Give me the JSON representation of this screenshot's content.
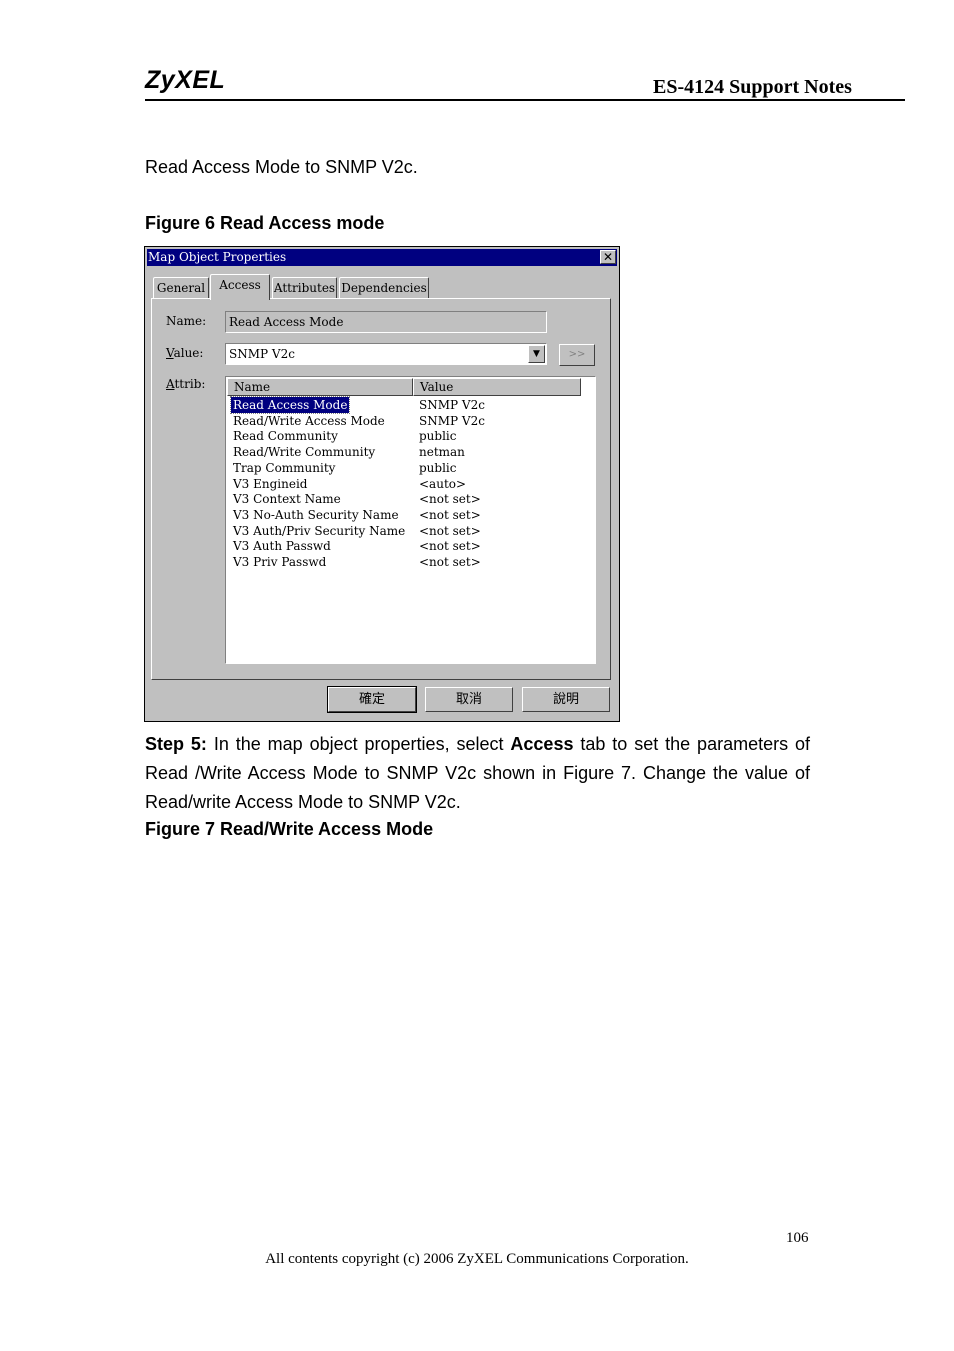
{
  "header": {
    "logo": "ZyXEL",
    "doc_title": "ES-4124 Support Notes"
  },
  "intro_text": "Read Access Mode to SNMP V2c.",
  "figure6_caption": "Figure 6 Read Access mode",
  "dialog": {
    "title": "Map Object Properties",
    "tabs": [
      "General",
      "Access",
      "Attributes",
      "Dependencies"
    ],
    "active_tab": "Access",
    "name_label": "Name:",
    "name_value": "Read Access Mode",
    "value_label_ul": "V",
    "value_label_rest": "alue:",
    "value_selected": "SNMP V2c",
    "more_button": ">>",
    "attrib_label_ul": "A",
    "attrib_label_rest": "ttrib:",
    "columns": [
      "Name",
      "Value"
    ],
    "rows": [
      {
        "name": "Read Access Mode",
        "value": "SNMP V2c",
        "selected": true
      },
      {
        "name": "Read/Write Access Mode",
        "value": "SNMP V2c"
      },
      {
        "name": "Read Community",
        "value": "public"
      },
      {
        "name": "Read/Write Community",
        "value": "netman"
      },
      {
        "name": "Trap Community",
        "value": "public"
      },
      {
        "name": "V3 Engineid",
        "value": "<auto>"
      },
      {
        "name": "V3 Context Name",
        "value": "<not set>"
      },
      {
        "name": "V3 No-Auth Security Name",
        "value": "<not set>"
      },
      {
        "name": "V3 Auth/Priv Security Name",
        "value": "<not set>"
      },
      {
        "name": "V3 Auth Passwd",
        "value": "<not set>"
      },
      {
        "name": "V3 Priv Passwd",
        "value": "<not set>"
      }
    ],
    "buttons": {
      "ok": "確定",
      "cancel": "取消",
      "help": "說明"
    }
  },
  "step5": {
    "label": "Step 5:",
    "text1": " In the map object properties, select ",
    "bold": "Access",
    "text2": " tab to set the parameters of Read /Write Access Mode to SNMP V2c shown in Figure 7. Change the value of Read/write Access Mode to SNMP V2c."
  },
  "figure7_caption": "Figure 7 Read/Write Access Mode",
  "footer": {
    "page_number": "106",
    "copyright": "All contents copyright (c) 2006 ZyXEL Communications Corporation."
  }
}
